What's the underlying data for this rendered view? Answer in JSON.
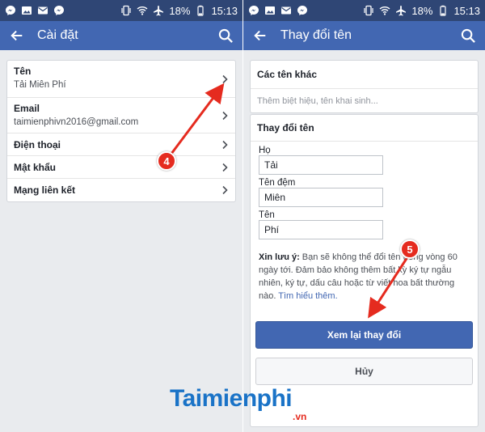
{
  "status_bar": {
    "battery": "18%",
    "time": "15:13"
  },
  "left_screen": {
    "title": "Cài đặt",
    "items": [
      {
        "label": "Tên",
        "value": "Tải Miên Phí"
      },
      {
        "label": "Email",
        "value": "taimienphivn2016@gmail.com"
      },
      {
        "label": "Điện thoại",
        "value": ""
      },
      {
        "label": "Mật khẩu",
        "value": ""
      },
      {
        "label": "Mạng liên kết",
        "value": ""
      }
    ]
  },
  "right_screen": {
    "title": "Thay đổi tên",
    "other_names": {
      "heading": "Các tên khác",
      "placeholder": "Thêm biệt hiệu, tên khai sinh..."
    },
    "change_name": {
      "heading": "Thay đổi tên",
      "fields": [
        {
          "label": "Họ",
          "value": "Tải"
        },
        {
          "label": "Tên đệm",
          "value": "Miên"
        },
        {
          "label": "Tên",
          "value": "Phí"
        }
      ],
      "note_bold": "Xin lưu ý:",
      "note_text": " Bạn sẽ không thể đổi tên trong vòng 60 ngày tới. Đảm bảo không thêm bất kỳ ký tự ngẫu nhiên, ký tự, dấu câu hoặc từ viết hoa bất thường nào.",
      "note_link": " Tìm hiểu thêm.",
      "review_button": "Xem lại thay đổi",
      "cancel_button": "Hủy"
    }
  },
  "annotations": {
    "step_left": "4",
    "step_right": "5"
  },
  "watermark": {
    "main": "Taimienphi",
    "sub": ".vn"
  },
  "colors": {
    "fb_blue": "#4267b2",
    "status_bar": "#2f4675",
    "annotation_red": "#e52b1f",
    "background": "#e9ebee"
  },
  "icons": [
    "messenger-icon",
    "image-icon",
    "mail-icon",
    "messenger-icon",
    "vibrate-icon",
    "wifi-icon",
    "airplane-icon",
    "battery-icon",
    "back-arrow-icon",
    "search-icon",
    "chevron-right-icon"
  ]
}
